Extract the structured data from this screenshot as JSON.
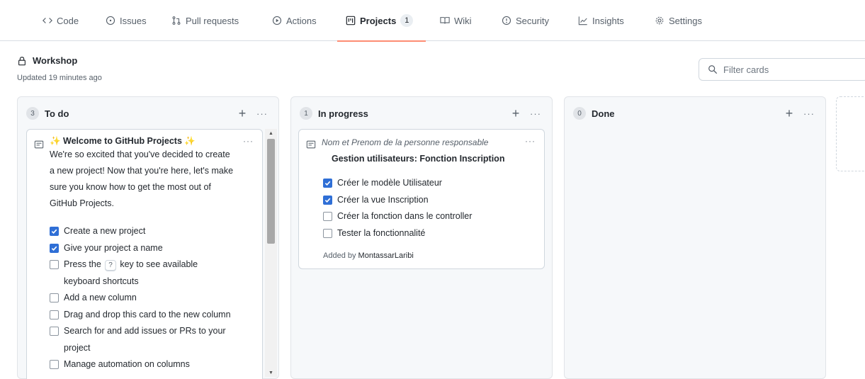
{
  "nav": {
    "tabs": [
      {
        "label": "Code",
        "icon": "code-icon"
      },
      {
        "label": "Issues",
        "icon": "issue-opened-icon"
      },
      {
        "label": "Pull requests",
        "icon": "git-pull-request-icon"
      },
      {
        "label": "Actions",
        "icon": "play-icon"
      },
      {
        "label": "Projects",
        "icon": "project-icon",
        "counter": "1",
        "selected": true
      },
      {
        "label": "Wiki",
        "icon": "book-icon"
      },
      {
        "label": "Security",
        "icon": "shield-icon"
      },
      {
        "label": "Insights",
        "icon": "graph-icon"
      },
      {
        "label": "Settings",
        "icon": "gear-icon"
      }
    ]
  },
  "project": {
    "title": "Workshop",
    "updated": "Updated 19 minutes ago",
    "filter_placeholder": "Filter cards"
  },
  "columns": [
    {
      "name": "To do",
      "count": "3",
      "add_label": "+",
      "more_label": "···",
      "cards": [
        {
          "type": "note",
          "title": "✨ Welcome to GitHub Projects ✨",
          "body": "We're so excited that you've decided to create a new project! Now that you're here, let's make sure you know how to get the most out of GitHub Projects.",
          "tasks": [
            {
              "text": "Create a new project",
              "checked": true
            },
            {
              "text": "Give your project a name",
              "checked": true
            },
            {
              "text_before": "Press the",
              "kbd": "?",
              "text_after": "key to see available keyboard shortcuts",
              "checked": false
            },
            {
              "text": "Add a new column",
              "checked": false
            },
            {
              "text": "Drag and drop this card to the new column",
              "checked": false
            },
            {
              "text": "Search for and add issues or PRs to your project",
              "checked": false
            },
            {
              "text": "Manage automation on columns",
              "checked": false
            }
          ]
        }
      ]
    },
    {
      "name": "In progress",
      "count": "1",
      "add_label": "+",
      "more_label": "···",
      "cards": [
        {
          "type": "note",
          "subtitle": "Nom et Prenom de la personne responsable",
          "title": "Gestion utilisateurs: Fonction Inscription",
          "tasks": [
            {
              "text": "Créer le modèle Utilisateur",
              "checked": true
            },
            {
              "text": "Créer la vue Inscription",
              "checked": true
            },
            {
              "text": "Créer la fonction dans le controller",
              "checked": false
            },
            {
              "text": "Tester la fonctionnalité",
              "checked": false
            }
          ],
          "added_by_prefix": "Added by",
          "added_by_user": "MontassarLaribi"
        }
      ]
    },
    {
      "name": "Done",
      "count": "0",
      "add_label": "+",
      "more_label": "···",
      "cards": []
    }
  ],
  "colors": {
    "accent_underline": "#fd8c73",
    "checkbox_checked": "#2f6fd6",
    "column_bg": "#f6f8fa"
  }
}
